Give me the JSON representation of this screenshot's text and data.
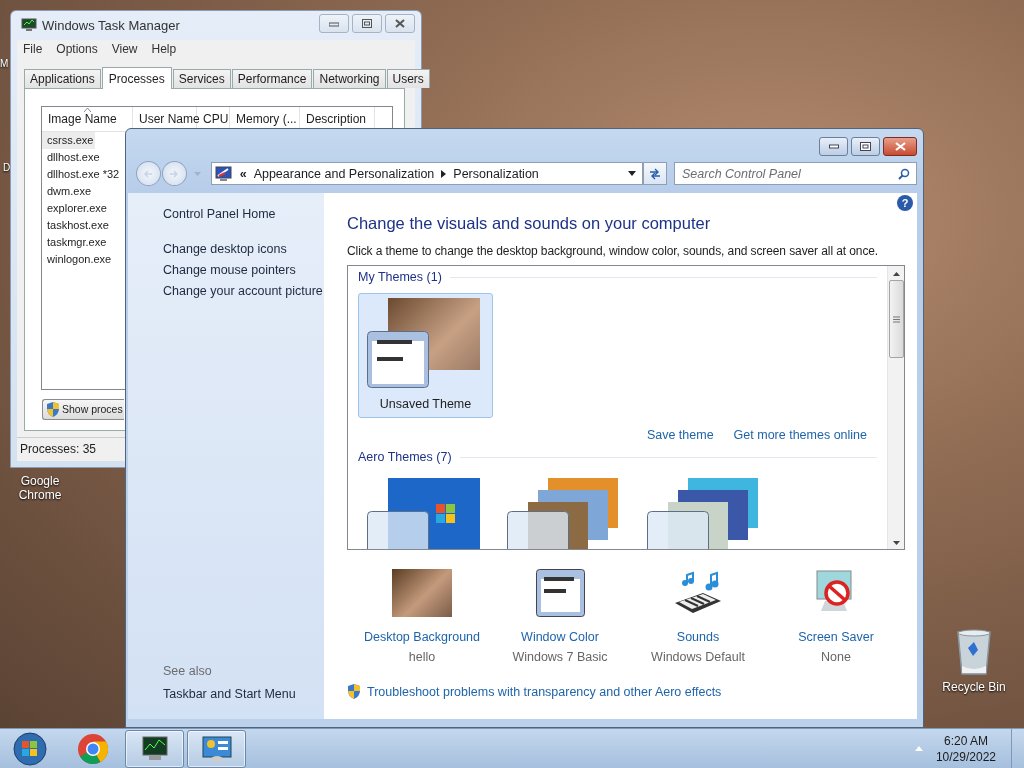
{
  "desktop": {
    "icons": [
      {
        "kind": "cut",
        "label": "M"
      },
      {
        "kind": "cut",
        "label": "D"
      },
      {
        "kind": "chrome",
        "label": "Google Chrome"
      },
      {
        "kind": "recycle_bin",
        "label": "Recycle Bin"
      }
    ]
  },
  "task_manager": {
    "title": "Windows Task Manager",
    "menu": [
      "File",
      "Options",
      "View",
      "Help"
    ],
    "tabs": [
      {
        "label": "Applications",
        "selected": false
      },
      {
        "label": "Processes",
        "selected": true
      },
      {
        "label": "Services",
        "selected": false
      },
      {
        "label": "Performance",
        "selected": false
      },
      {
        "label": "Networking",
        "selected": false
      },
      {
        "label": "Users",
        "selected": false
      }
    ],
    "columns": [
      "Image Name",
      "User Name",
      "CPU",
      "Memory (...",
      "Description"
    ],
    "rows": [
      {
        "name": "csrss.exe",
        "selected": true
      },
      {
        "name": "dllhost.exe",
        "selected": false
      },
      {
        "name": "dllhost.exe *32",
        "selected": false
      },
      {
        "name": "dwm.exe",
        "selected": false
      },
      {
        "name": "explorer.exe",
        "selected": false
      },
      {
        "name": "taskhost.exe",
        "selected": false
      },
      {
        "name": "taskmgr.exe",
        "selected": false
      },
      {
        "name": "winlogon.exe",
        "selected": false
      }
    ],
    "button": "Show proces",
    "status": "Processes: 35"
  },
  "control_panel": {
    "breadcrumb_overflow": "«",
    "breadcrumb": [
      "Appearance and Personalization",
      "Personalization"
    ],
    "search": {
      "placeholder": "Search Control Panel"
    },
    "sidebar": {
      "home": "Control Panel Home",
      "links": [
        "Change desktop icons",
        "Change mouse pointers",
        "Change your account picture"
      ],
      "see_also_heading": "See also",
      "see_also": [
        "Taskbar and Start Menu"
      ]
    },
    "help_mark": "?",
    "heading": "Change the visuals and sounds on your computer",
    "intro": "Click a theme to change the desktop background, window color, sounds, and screen saver all at once.",
    "theme_groups": [
      {
        "title": "My Themes (1)",
        "themes": [
          {
            "name": "Unsaved Theme",
            "selected": true
          }
        ],
        "actions": [
          "Save theme",
          "Get more themes online"
        ]
      },
      {
        "title": "Aero Themes (7)",
        "themes": [
          {
            "selected": false
          },
          {
            "selected": false
          },
          {
            "selected": false
          }
        ]
      }
    ],
    "settings": [
      {
        "kind": "background",
        "title": "Desktop Background",
        "value": "hello"
      },
      {
        "kind": "window_color",
        "title": "Window Color",
        "value": "Windows 7 Basic"
      },
      {
        "kind": "sounds",
        "title": "Sounds",
        "value": "Windows Default"
      },
      {
        "kind": "screen_saver",
        "title": "Screen Saver",
        "value": "None"
      }
    ],
    "troubleshoot": "Troubleshoot problems with transparency and other Aero effects"
  },
  "taskbar": {
    "buttons": [
      {
        "kind": "start",
        "open": false
      },
      {
        "kind": "chrome",
        "open": false
      },
      {
        "kind": "task_manager",
        "open": true
      },
      {
        "kind": "control_panel",
        "open": true
      }
    ],
    "clock": {
      "time": "6:20 AM",
      "date": "10/29/2022"
    }
  }
}
